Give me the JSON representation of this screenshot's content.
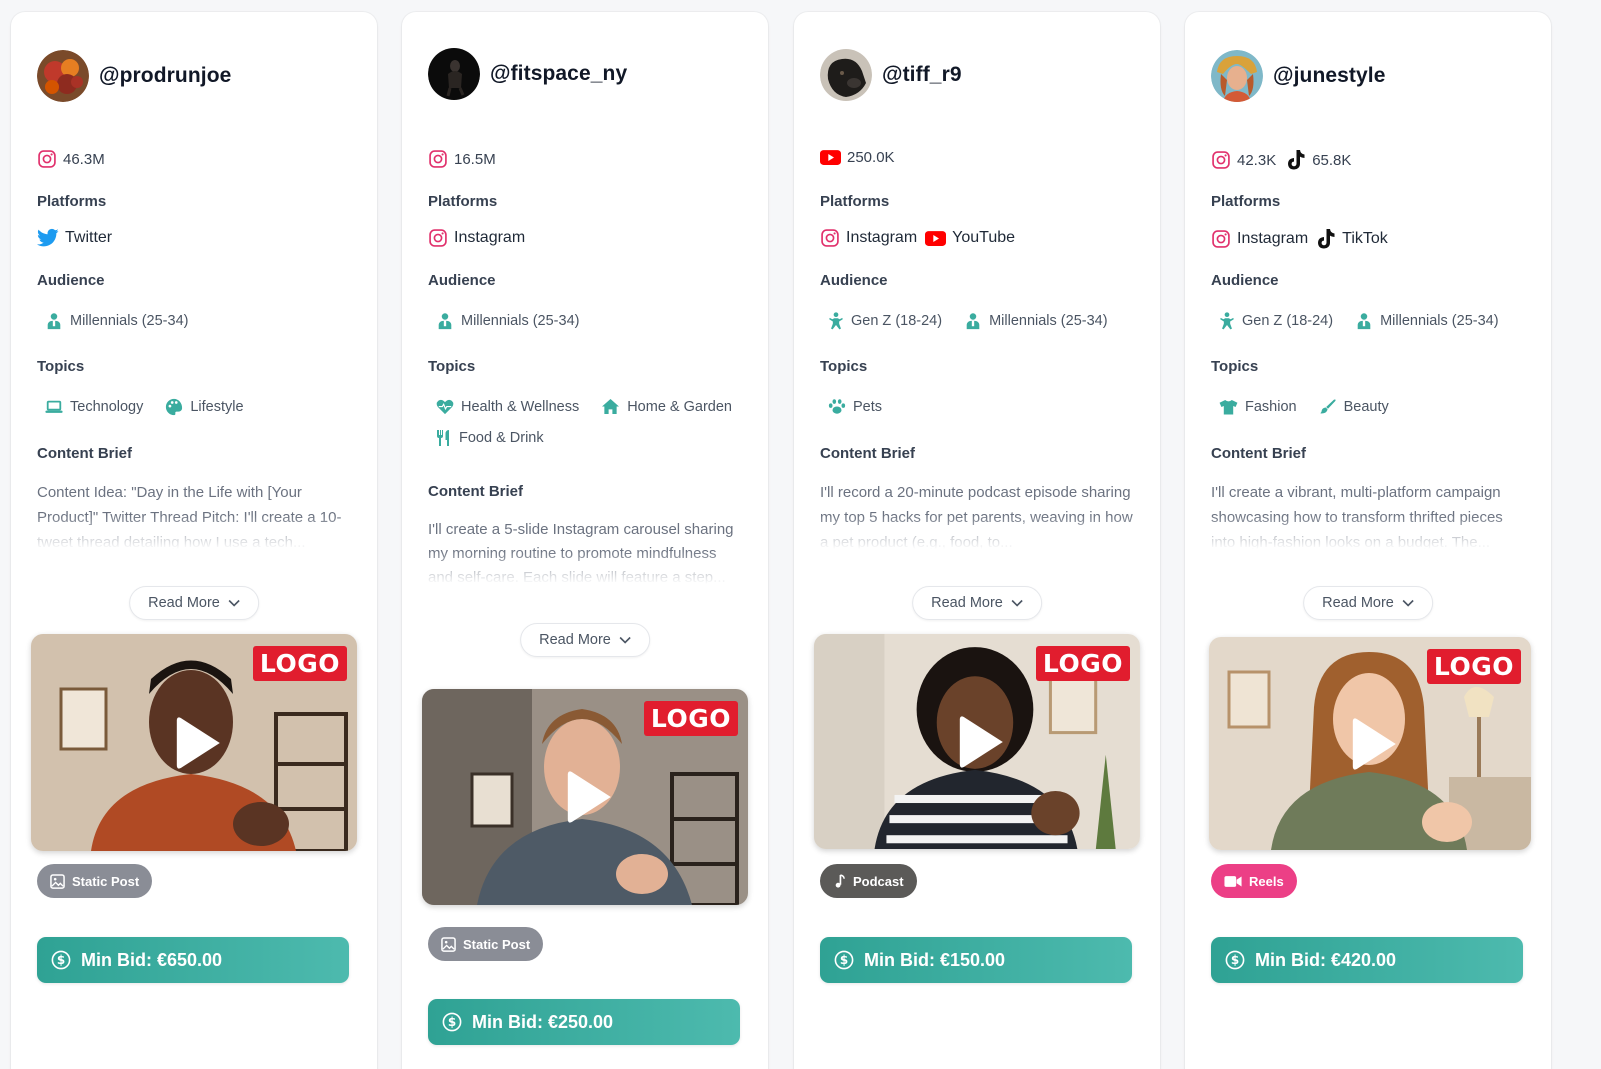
{
  "labels": {
    "platforms": "Platforms",
    "audience": "Audience",
    "topics": "Topics",
    "content_brief": "Content Brief",
    "read_more": "Read More",
    "logo": "LOGO"
  },
  "cards": [
    {
      "handle": "@prodrunjoe",
      "stats": [
        {
          "platform": "instagram",
          "value": "46.3M"
        }
      ],
      "platforms": [
        {
          "icon": "twitter-icon",
          "label": "Twitter"
        }
      ],
      "audience": [
        {
          "icon": "millennials-icon",
          "label": "Millennials (25-34)"
        }
      ],
      "topics": [
        {
          "icon": "laptop-icon",
          "label": "Technology"
        },
        {
          "icon": "palette-icon",
          "label": "Lifestyle"
        }
      ],
      "brief": "Content Idea: \"Day in the Life with [Your Product]\" Twitter Thread Pitch: I'll create a 10-tweet thread detailing how I use a tech...",
      "format": "Static Post",
      "min_bid": "Min Bid: €650.00"
    },
    {
      "handle": "@fitspace_ny",
      "stats": [
        {
          "platform": "instagram",
          "value": "16.5M"
        }
      ],
      "platforms": [
        {
          "icon": "instagram-icon",
          "label": "Instagram"
        }
      ],
      "audience": [
        {
          "icon": "millennials-icon",
          "label": "Millennials (25-34)"
        }
      ],
      "topics": [
        {
          "icon": "heart-pulse-icon",
          "label": "Health & Wellness"
        },
        {
          "icon": "home-icon",
          "label": "Home & Garden"
        },
        {
          "icon": "utensils-icon",
          "label": "Food & Drink"
        }
      ],
      "brief": "I'll create a 5-slide Instagram carousel sharing my morning routine to promote mindfulness and self-care. Each slide will feature a step...",
      "format": "Static Post",
      "min_bid": "Min Bid: €250.00"
    },
    {
      "handle": "@tiff_r9",
      "stats": [
        {
          "platform": "youtube",
          "value": "250.0K"
        }
      ],
      "platforms": [
        {
          "icon": "instagram-icon",
          "label": "Instagram"
        },
        {
          "icon": "youtube-icon",
          "label": "YouTube"
        }
      ],
      "audience": [
        {
          "icon": "genz-icon",
          "label": "Gen Z (18-24)"
        },
        {
          "icon": "millennials-icon",
          "label": "Millennials (25-34)"
        }
      ],
      "topics": [
        {
          "icon": "paw-icon",
          "label": "Pets"
        }
      ],
      "brief": "I'll record a 20-minute podcast episode sharing my top 5 hacks for pet parents, weaving in how a pet product (e.g., food, to...",
      "format": "Podcast",
      "min_bid": "Min Bid: €150.00"
    },
    {
      "handle": "@junestyle",
      "stats": [
        {
          "platform": "instagram",
          "value": "42.3K"
        },
        {
          "platform": "tiktok",
          "value": "65.8K"
        }
      ],
      "platforms": [
        {
          "icon": "instagram-icon",
          "label": "Instagram"
        },
        {
          "icon": "tiktok-icon",
          "label": "TikTok"
        }
      ],
      "audience": [
        {
          "icon": "genz-icon",
          "label": "Gen Z (18-24)"
        },
        {
          "icon": "millennials-icon",
          "label": "Millennials (25-34)"
        }
      ],
      "topics": [
        {
          "icon": "tshirt-icon",
          "label": "Fashion"
        },
        {
          "icon": "brush-icon",
          "label": "Beauty"
        }
      ],
      "brief": "I'll create a vibrant, multi-platform campaign showcasing how to transform thrifted pieces into high-fashion looks on a budget. The...",
      "format": "Reels",
      "min_bid": "Min Bid: €420.00"
    }
  ],
  "colors": {
    "teal": "#3aac9f",
    "instagram": "#e1306c",
    "youtube": "#ff0000",
    "twitter": "#1d9bf0",
    "logo_red": "#e11d2e",
    "reels_pink": "#ec3f86"
  }
}
